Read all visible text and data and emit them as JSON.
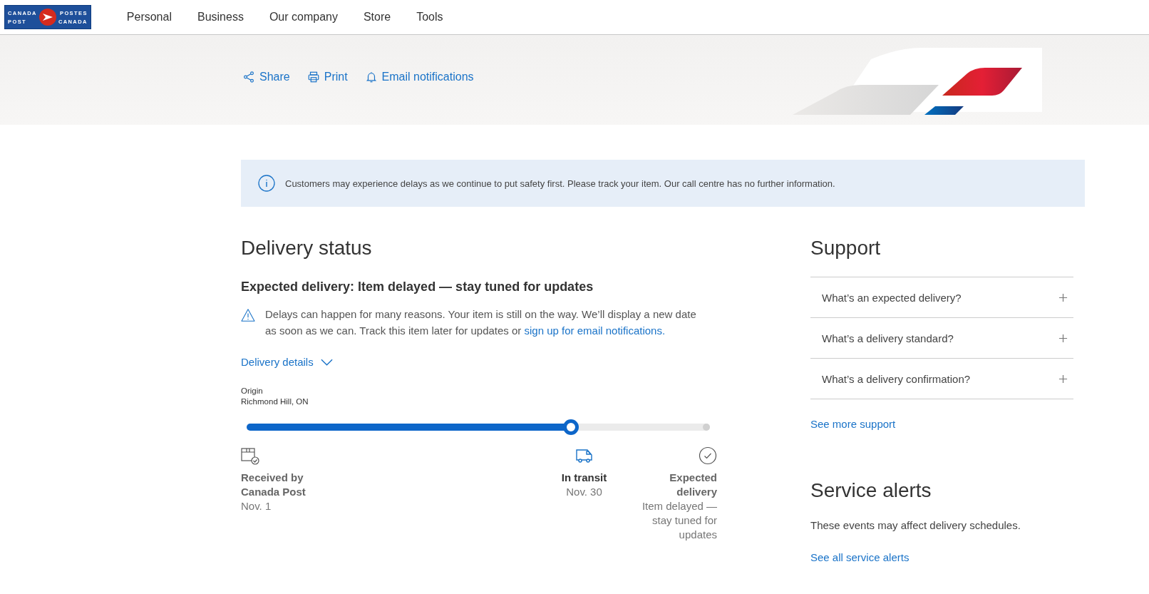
{
  "header": {
    "logo": {
      "top_left": "CANADA",
      "bottom_left": "POST",
      "top_right": "POSTES",
      "bottom_right": "CANADA"
    },
    "nav": [
      "Personal",
      "Business",
      "Our company",
      "Store",
      "Tools"
    ]
  },
  "actions": [
    {
      "kind": "share",
      "label": "Share"
    },
    {
      "kind": "print",
      "label": "Print"
    },
    {
      "kind": "bell",
      "label": "Email notifications"
    }
  ],
  "notice": {
    "text": "Customers may experience delays as we continue to put safety first. Please track your item. Our call centre has no further information."
  },
  "delivery_status": {
    "title": "Delivery status",
    "expected": "Expected delivery: Item delayed — stay tuned for updates",
    "warning": {
      "text": "Delays can happen for many reasons. Your item is still on the way. We’ll display a new date as soon as we can. Track this item later for updates or",
      "link": "sign up for email notifications."
    },
    "details_toggle": {
      "label": "Delivery details",
      "expanded": false
    },
    "origin": {
      "label": "Origin",
      "value": "Richmond Hill, ON"
    },
    "progress": {
      "level": 0.7
    },
    "steps": [
      {
        "kind": "received",
        "title": "Received by Canada Post",
        "date": "Nov. 1",
        "current": false
      },
      {
        "kind": "transit",
        "title": "In transit",
        "date": "Nov. 30",
        "current": true
      },
      {
        "kind": "delivered",
        "title": "Expected delivery",
        "date": "Item delayed — stay tuned for updates",
        "current": false
      }
    ]
  },
  "support": {
    "title": "Support",
    "items": [
      {
        "label": "What’s an expected delivery?",
        "expanded": false
      },
      {
        "label": "What’s a delivery standard?",
        "expanded": false
      },
      {
        "label": "What’s a delivery confirmation?",
        "expanded": false
      }
    ],
    "more": "See more support"
  },
  "service_alerts": {
    "title": "Service alerts",
    "text": "These events may affect delivery schedules.",
    "link": "See all service alerts"
  }
}
